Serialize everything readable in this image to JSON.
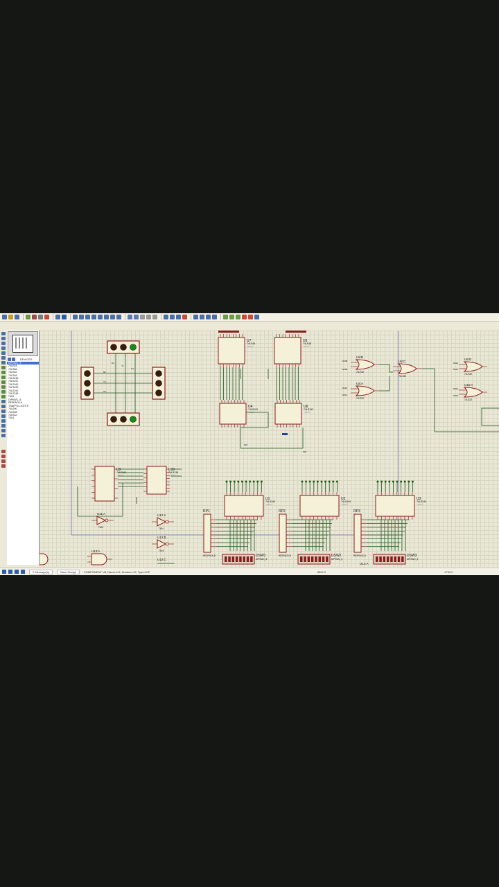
{
  "panel": {
    "tab_label": "DEVICES",
    "devices": [
      "74LS00",
      "74LS04",
      "74LS08",
      "74LS32",
      "74LS48",
      "74LS138",
      "74LS157",
      "74LS160",
      "74LS163",
      "74LS192",
      "74LS245",
      "7404",
      "DIPSWC_8",
      "RESPACK-8",
      "TRAFFIC LIGHTS",
      "74LS00",
      "74LS08",
      "74LS32",
      "7404"
    ],
    "selected_index": 0,
    "selected_label": "DIPSWC_8"
  },
  "status": {
    "messages": "2 Message(s)",
    "design": "Base Design",
    "component_info": "COMPONENT U8, Name=U2, Number=12, Type=DIP",
    "coord1": "-3500.0",
    "coord2": "-1700.0"
  },
  "schematic": {
    "upper_chips": [
      {
        "ref": "U7",
        "part": "74LS48"
      },
      {
        "ref": "U5",
        "part": "74LS48"
      },
      {
        "ref": "U4",
        "part": "74LS192"
      },
      {
        "ref": "U6",
        "part": "74LS192"
      }
    ],
    "gates": [
      {
        "ref": "U8:B",
        "part": "74LS32"
      },
      {
        "ref": "U8:A",
        "part": "74LS32"
      },
      {
        "ref": "U8:C",
        "part": "74LS32"
      },
      {
        "ref": "U8:D",
        "part": "74LS32"
      },
      {
        "ref": "U15:A",
        "part": "74LS32"
      }
    ],
    "gate_inputs": [
      "D008",
      "D009",
      "D010",
      "D011",
      "D010",
      "D011",
      "D012",
      "D013"
    ],
    "mid_chips": [
      {
        "ref": "U9",
        "part": "74LS163"
      },
      {
        "ref": "U10",
        "part": "74LS138"
      }
    ],
    "inverters": [
      {
        "ref": "U11:A",
        "part": "7404"
      },
      {
        "ref": "U12:A",
        "part": "7404"
      },
      {
        "ref": "U12:B",
        "part": "7404"
      },
      {
        "ref": "U12:C",
        "part": ""
      }
    ],
    "and_gates": [
      {
        "ref": "U13:A"
      },
      {
        "ref": "U14:A"
      }
    ],
    "buffers": [
      {
        "ref": "U1",
        "part": "74LS245"
      },
      {
        "ref": "U2",
        "part": "74LS245"
      },
      {
        "ref": "U3",
        "part": "74LS245"
      }
    ],
    "rpacks": [
      {
        "ref": "RP1",
        "part": "RESPACK-8"
      },
      {
        "ref": "RP2",
        "part": "RESPACK-8"
      },
      {
        "ref": "RP3",
        "part": "RESPACK-8"
      }
    ],
    "dipswitches": [
      {
        "ref": "DSW1",
        "part": "DIPSWC_8"
      },
      {
        "ref": "DSW2",
        "part": "DIPSWC_8"
      },
      {
        "ref": "DSW3",
        "part": "DIPSWC_8"
      }
    ],
    "text_hint": "<TEXT>",
    "traffic_labels": [
      "R1",
      "Y1",
      "G1",
      "R2",
      "Y2",
      "G2"
    ],
    "colors": {
      "part_outline": "#8b1a1a",
      "part_fill": "#f5f0d8",
      "wire": "#1f5a1f",
      "frame": "#6c6fb5",
      "pin": "#2040a0",
      "light_red": "#d41f1f",
      "light_yellow": "#d8a800",
      "light_green": "#1a8a1a",
      "light_off": "#3a1a0a"
    }
  }
}
